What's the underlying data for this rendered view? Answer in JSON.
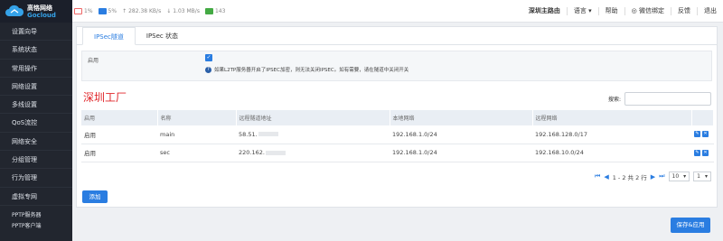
{
  "brand": {
    "name_cn": "高恪网络",
    "name_en": "Gocloud",
    "color": "#35a2e8"
  },
  "stats": {
    "cpu": "1%",
    "mem": "5%",
    "upload": "282.38 KB/s",
    "download": "1.03 MB/s",
    "connections": "143"
  },
  "topmenu": {
    "router": "深圳主路由",
    "language": "语言",
    "help": "帮助",
    "wechat": "微信绑定",
    "feedback": "反馈",
    "logout": "退出"
  },
  "sidebar": {
    "items": [
      "设置向导",
      "系统状态",
      "常用操作",
      "网络设置",
      "多线设置",
      "QoS流控",
      "网络安全",
      "分组管理",
      "行为管理",
      "虚拟专网"
    ],
    "subitems": [
      "PPTP服务器",
      "PPTP客户端"
    ]
  },
  "tabs": [
    "IPSec隧道",
    "IPSec 状态"
  ],
  "enable": {
    "label": "启用",
    "note": "如果L2TP服务器开启了IPSEC加密，则无法关闭IPSEC。如有需要，请在隧道中关闭开关"
  },
  "group_title": "深圳工厂",
  "search": {
    "label": "搜索:",
    "placeholder": ""
  },
  "table": {
    "headers": [
      "启用",
      "名称",
      "远程隧道地址",
      "本地网络",
      "远程网络",
      ""
    ],
    "rows": [
      {
        "enabled": "启用",
        "name": "main",
        "remote": "58.51.",
        "local": "192.168.1.0/24",
        "remote_net": "192.168.128.0/17"
      },
      {
        "enabled": "启用",
        "name": "sec",
        "remote": "220.162.",
        "local": "192.168.1.0/24",
        "remote_net": "192.168.10.0/24"
      }
    ]
  },
  "pager": {
    "info": "1 - 2 共 2 行",
    "page_size": "10",
    "page": "1"
  },
  "buttons": {
    "add": "添加",
    "save": "保存&应用"
  },
  "accent": "#2a7de1"
}
